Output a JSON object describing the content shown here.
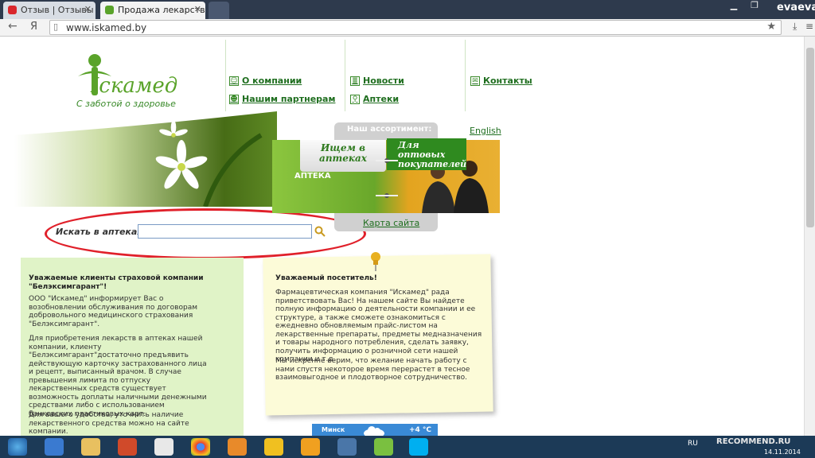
{
  "browser": {
    "tabs": [
      {
        "label": "Отзыв | Отзывы покуп",
        "active": false
      },
      {
        "label": "Продажа лекарственн",
        "active": true
      }
    ],
    "user": "evaeva",
    "yandex_glyph": "Я",
    "url": "www.iskamed.by"
  },
  "site": {
    "logo_text": "Іскамед",
    "tagline": "С заботой о здоровье",
    "nav": {
      "about": "О компании",
      "partners": "Нашим партнерам",
      "news": "Новости",
      "pharmacies": "Аптеки",
      "contacts": "Контакты"
    },
    "search": {
      "label": "Искать в аптеках:",
      "value": ""
    },
    "assortment": {
      "title": "Наш ассортимент:",
      "left_button": "Ищем в аптеках",
      "right_button": "Для оптовых покупателей",
      "sign": "АПТЕКА"
    },
    "english_link": "English",
    "sitemap_link": "Карта сайта",
    "left_panel": {
      "title": "Уважаемые клиенты страховой компании \"Белэксимгарант\"!",
      "p1": "ООО \"Искамед\" информирует Вас о возобновлении обслуживания по договорам добровольного медицинского страхования \"Белэксимгарант\".",
      "p2": "Для приобретения лекарств в аптеках нашей компании, клиенту \"Белэксимгарант\"достаточно предъявить действующую карточку застрахованного лица и рецепт, выписанный врачом. В случае превышения лимита по отпуску лекарственных средств существует возможность доплаты наличными денежными средствами либо с использованием банковских пластиковых карт.",
      "p3": "Для вашего удобства, уточнить наличие лекарственного средства можно на сайте компании."
    },
    "note": {
      "title": "Уважаемый посетитель!",
      "p1": "Фармацевтическая компания \"Искамед\" рада приветствовать Вас! На нашем сайте Вы найдете полную информацию о деятельности компании и ее структуре, а также сможете ознакомиться с ежедневно обновляемым прайс-листом на лекарственные препараты, предметы медназначения и товары народного потребления, сделать заявку, получить информацию о розничной сети нашей компании и т.д.",
      "p2": "Мы искренне верим, что желание начать работу с нами спустя некоторое время перерастет в тесное взаимовыгодное и плодотворное сотрудничество."
    },
    "weather": {
      "city": "Минск",
      "temp": "+4 °C"
    }
  },
  "taskbar": {
    "lang": "RU",
    "watermark": "RECOMMEND.RU",
    "date": "14.11.2014"
  },
  "colors": {
    "brand_green": "#5aa32a",
    "link_green": "#1f6e1f",
    "annotation_red": "#e0202a",
    "panel_green": "#e0f3c7",
    "note_yellow": "#fcfbd8"
  }
}
